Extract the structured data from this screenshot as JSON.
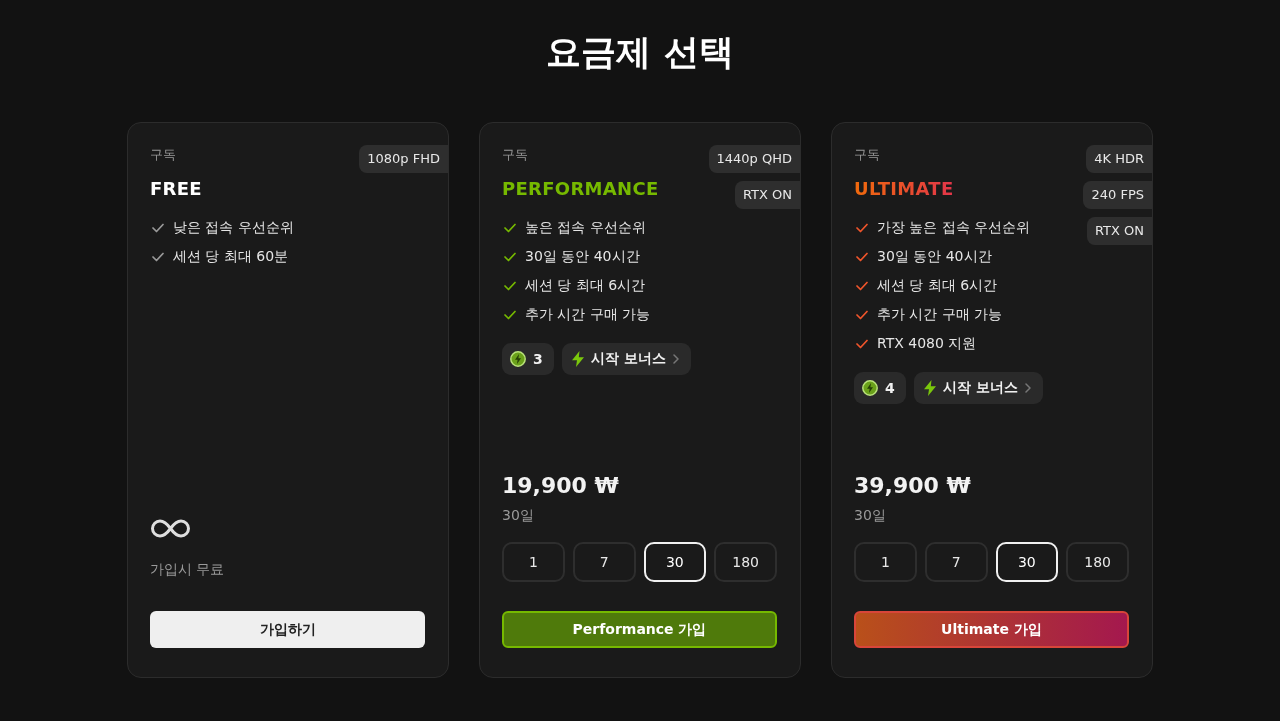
{
  "title": "요금제 선택",
  "plans": [
    {
      "kind": "free",
      "label": "구독",
      "name": "FREE",
      "badges": [
        "1080p FHD"
      ],
      "features": [
        "낮은 접속 우선순위",
        "세션 당 최대 60분"
      ],
      "note": "가입시 무료",
      "cta": "가입하기"
    },
    {
      "kind": "performance",
      "label": "구독",
      "name": "PERFORMANCE",
      "badges": [
        "1440p QHD",
        "RTX ON"
      ],
      "features": [
        "높은 접속 우선순위",
        "30일 동안 40시간",
        "세션 당 최대 6시간",
        "추가 시간 구매 가능"
      ],
      "coins": "3",
      "bonus": "시작 보너스",
      "price": "19,900 ₩",
      "period": "30일",
      "durations": [
        {
          "label": "1",
          "selected": false
        },
        {
          "label": "7",
          "selected": false
        },
        {
          "label": "30",
          "selected": true
        },
        {
          "label": "180",
          "selected": false
        }
      ],
      "cta": "Performance 가입"
    },
    {
      "kind": "ultimate",
      "label": "구독",
      "name": "ULTIMATE",
      "badges": [
        "4K HDR",
        "240 FPS",
        "RTX ON"
      ],
      "features": [
        "가장 높은 접속 우선순위",
        "30일 동안 40시간",
        "세션 당 최대 6시간",
        "추가 시간 구매 가능",
        "RTX 4080 지원"
      ],
      "coins": "4",
      "bonus": "시작 보너스",
      "price": "39,900 ₩",
      "period": "30일",
      "durations": [
        {
          "label": "1",
          "selected": false
        },
        {
          "label": "7",
          "selected": false
        },
        {
          "label": "30",
          "selected": true
        },
        {
          "label": "180",
          "selected": false
        }
      ],
      "cta": "Ultimate 가입"
    }
  ]
}
